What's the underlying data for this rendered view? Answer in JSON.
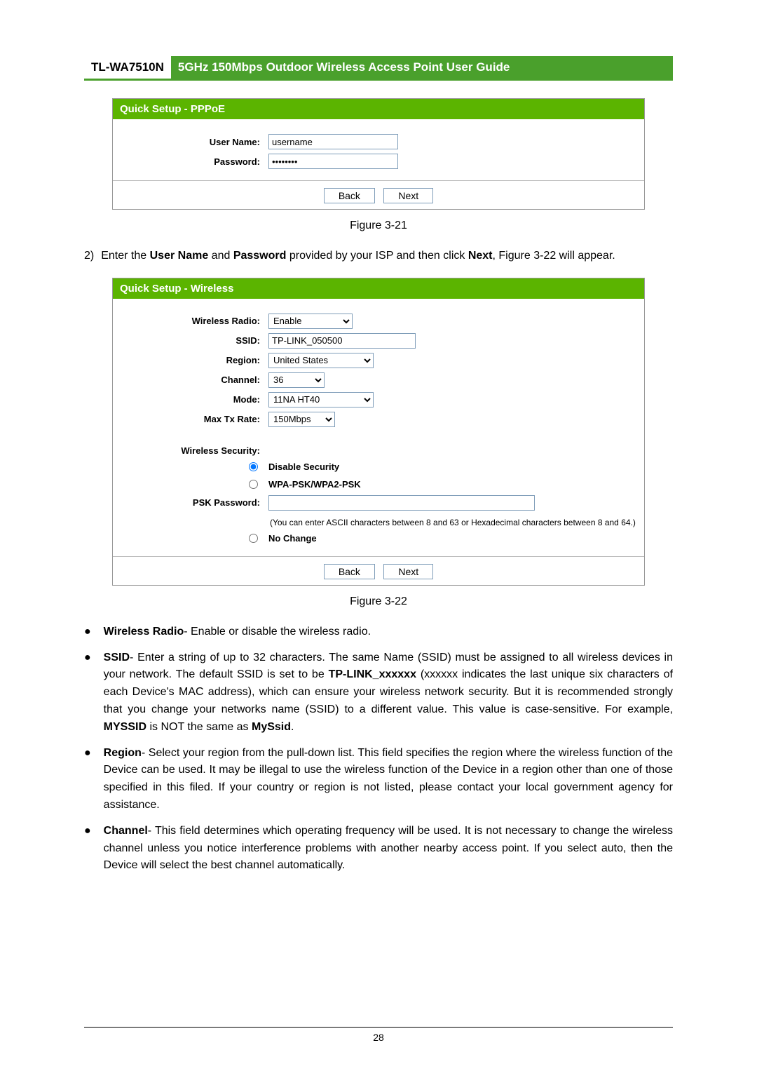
{
  "header": {
    "model": "TL-WA7510N",
    "title": "5GHz 150Mbps Outdoor Wireless Access Point User Guide"
  },
  "panel1": {
    "title": "Quick Setup - PPPoE",
    "labels": {
      "user": "User Name:",
      "pass": "Password:"
    },
    "fields": {
      "username": "username",
      "password": "••••••••"
    },
    "buttons": {
      "back": "Back",
      "next": "Next"
    }
  },
  "caption1": "Figure 3-21",
  "step2": {
    "num": "2)",
    "body_prefix": "Enter the ",
    "b1": "User Name",
    "mid1": " and ",
    "b2": "Password",
    "rest": " provided by your ISP and then click ",
    "b3": "Next",
    "tail": ", Figure 3-22 will appear."
  },
  "panel2": {
    "title": "Quick Setup - Wireless",
    "labels": {
      "wr": "Wireless Radio:",
      "ssid": "SSID:",
      "region": "Region:",
      "channel": "Channel:",
      "mode": "Mode:",
      "rate": "Max Tx Rate:",
      "sec": "Wireless Security:",
      "psk": "PSK Password:"
    },
    "values": {
      "wr": "Enable",
      "ssid": "TP-LINK_050500",
      "region": "United States",
      "channel": "36",
      "mode": "11NA HT40",
      "rate": "150Mbps"
    },
    "opts": {
      "disable": "Disable Security",
      "wpa": "WPA-PSK/WPA2-PSK",
      "nochange": "No Change"
    },
    "help": "(You can enter ASCII characters between 8 and 63 or Hexadecimal characters between 8 and 64.)",
    "buttons": {
      "back": "Back",
      "next": "Next"
    }
  },
  "caption2": "Figure 3-22",
  "bullets": {
    "wr_b": "Wireless Radio",
    "wr_t": "- Enable or disable the wireless radio.",
    "ssid_b": "SSID",
    "ssid_t1": "- Enter a string of up to 32 characters. The same Name (SSID) must be assigned to all wireless devices in your network. The default SSID is set to be ",
    "ssid_b2": "TP-LINK_xxxxxx",
    "ssid_t2": " (xxxxxx indicates the last unique six characters of each Device's MAC address), which can ensure your wireless network security. But it is recommended strongly that you change your networks name (SSID) to a different value. This value is case-sensitive. For example, ",
    "ssid_b3": "MYSSID",
    "ssid_t3": " is NOT the same as ",
    "ssid_b4": "MySsid",
    "ssid_t4": ".",
    "reg_b": "Region",
    "reg_t": "- Select your region from the pull-down list. This field specifies the region where the wireless function of the Device can be used. It may be illegal to use the wireless function of the Device in a region other than one of those specified in this filed. If your country or region is not listed, please contact your local government agency for assistance.",
    "ch_b": "Channel",
    "ch_t": "- This field determines which operating frequency will be used. It is not necessary to change the wireless channel unless you notice interference problems with another nearby access point. If you select auto, then the Device will select the best channel automatically."
  },
  "pagenum": "28"
}
